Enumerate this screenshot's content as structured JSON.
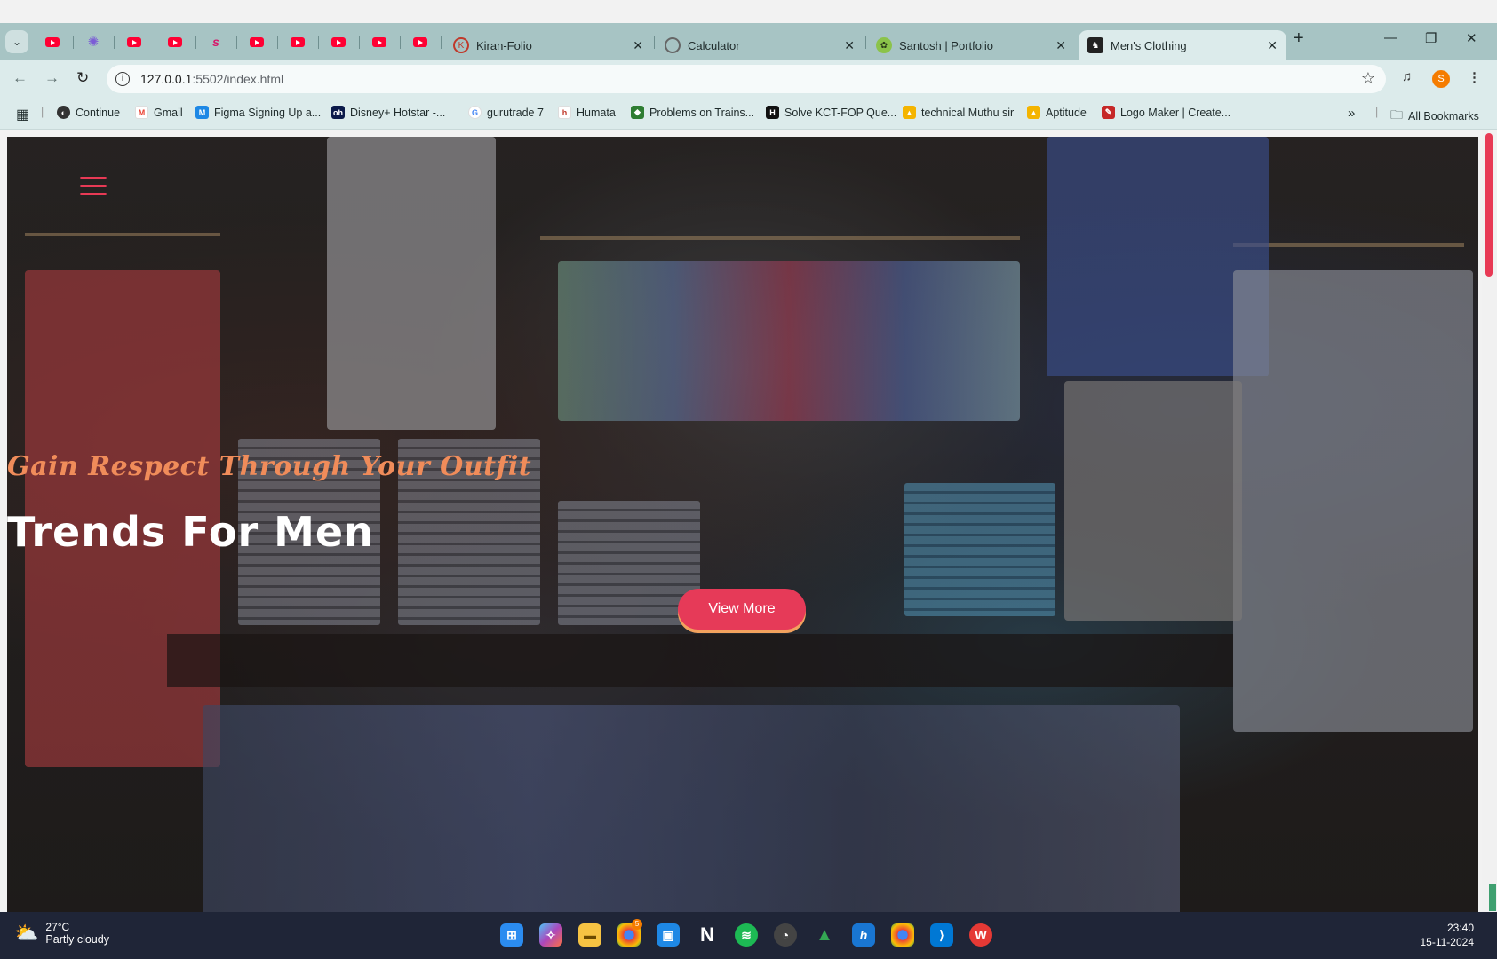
{
  "browser": {
    "tabs": [
      {
        "title": "Kiran-Folio"
      },
      {
        "title": "Calculator"
      },
      {
        "title": "Santosh | Portfolio"
      },
      {
        "title": "Men's Clothing"
      }
    ],
    "url_host": "127.0.0.1",
    "url_path": ":5502/index.html",
    "profile_initial": "S"
  },
  "bookmarks": [
    {
      "label": "Continue"
    },
    {
      "label": "Gmail"
    },
    {
      "label": "Figma Signing Up a..."
    },
    {
      "label": "Disney+ Hotstar -..."
    },
    {
      "label": "gurutrade 7"
    },
    {
      "label": "Humata"
    },
    {
      "label": "Problems on Trains..."
    },
    {
      "label": "Solve KCT-FOP Que..."
    },
    {
      "label": "technical Muthu sir"
    },
    {
      "label": "Aptitude"
    },
    {
      "label": "Logo Maker | Create..."
    }
  ],
  "all_bookmarks": "All Bookmarks",
  "hero": {
    "tagline": "Gain Respect Through Your Outfit",
    "headline": "Trends For Men",
    "cta": "View More"
  },
  "colors": {
    "accent": "#e63a58",
    "tagline": "#f08c5a",
    "tabbar": "#a7c4c4"
  },
  "taskbar": {
    "temperature": "27°C",
    "condition": "Partly cloudy",
    "time": "23:40",
    "date": "15-11-2024",
    "chrome_badge": "5"
  }
}
